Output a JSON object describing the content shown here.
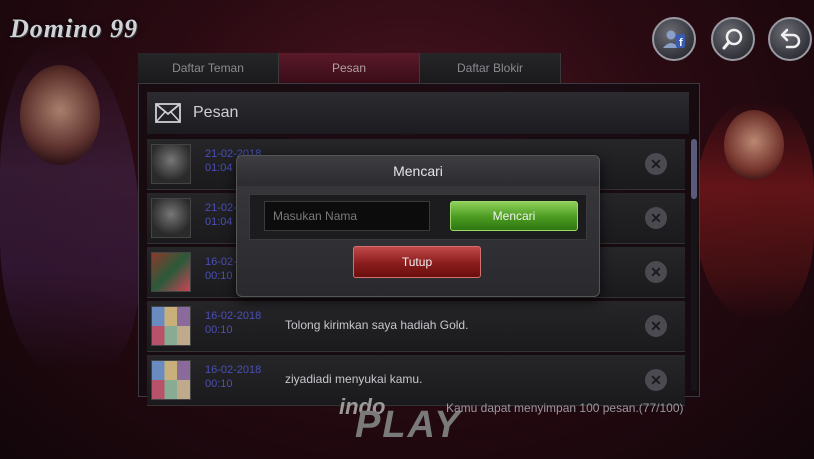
{
  "app": {
    "logo": "Domino 99"
  },
  "top_buttons": [
    {
      "icon": "user-facebook-icon"
    },
    {
      "icon": "search-icon"
    },
    {
      "icon": "back-icon"
    }
  ],
  "tabs": [
    {
      "label": "Daftar Teman",
      "active": false
    },
    {
      "label": "Pesan",
      "active": true
    },
    {
      "label": "Daftar Blokir",
      "active": false
    }
  ],
  "panel": {
    "title": "Pesan",
    "rows": [
      {
        "date": "21-02-2018",
        "time": "01:04",
        "message": "",
        "avatar": "silhouette"
      },
      {
        "date": "21-02-2018",
        "time": "01:04",
        "message": "",
        "avatar": "silhouette"
      },
      {
        "date": "16-02-2018",
        "time": "00:10",
        "message": "",
        "avatar": "photo"
      },
      {
        "date": "16-02-2018",
        "time": "00:10",
        "message": "Tolong kirimkan saya hadiah Gold.",
        "avatar": "mosaic"
      },
      {
        "date": "16-02-2018",
        "time": "00:10",
        "message": "ziyadiadi menyukai kamu.",
        "avatar": "mosaic"
      }
    ],
    "footer_note": "Kamu dapat menyimpan 100 pesan.(77/100)"
  },
  "footer_logo": {
    "line1": "indo",
    "line2": "PLAY"
  },
  "modal": {
    "title": "Mencari",
    "input_placeholder": "Masukan Nama",
    "input_value": "",
    "search_label": "Mencari",
    "close_label": "Tutup"
  },
  "colors": {
    "accent_green": "#4a9a20",
    "accent_red": "#8a1c1c",
    "date_blue": "#4b4fb8"
  }
}
